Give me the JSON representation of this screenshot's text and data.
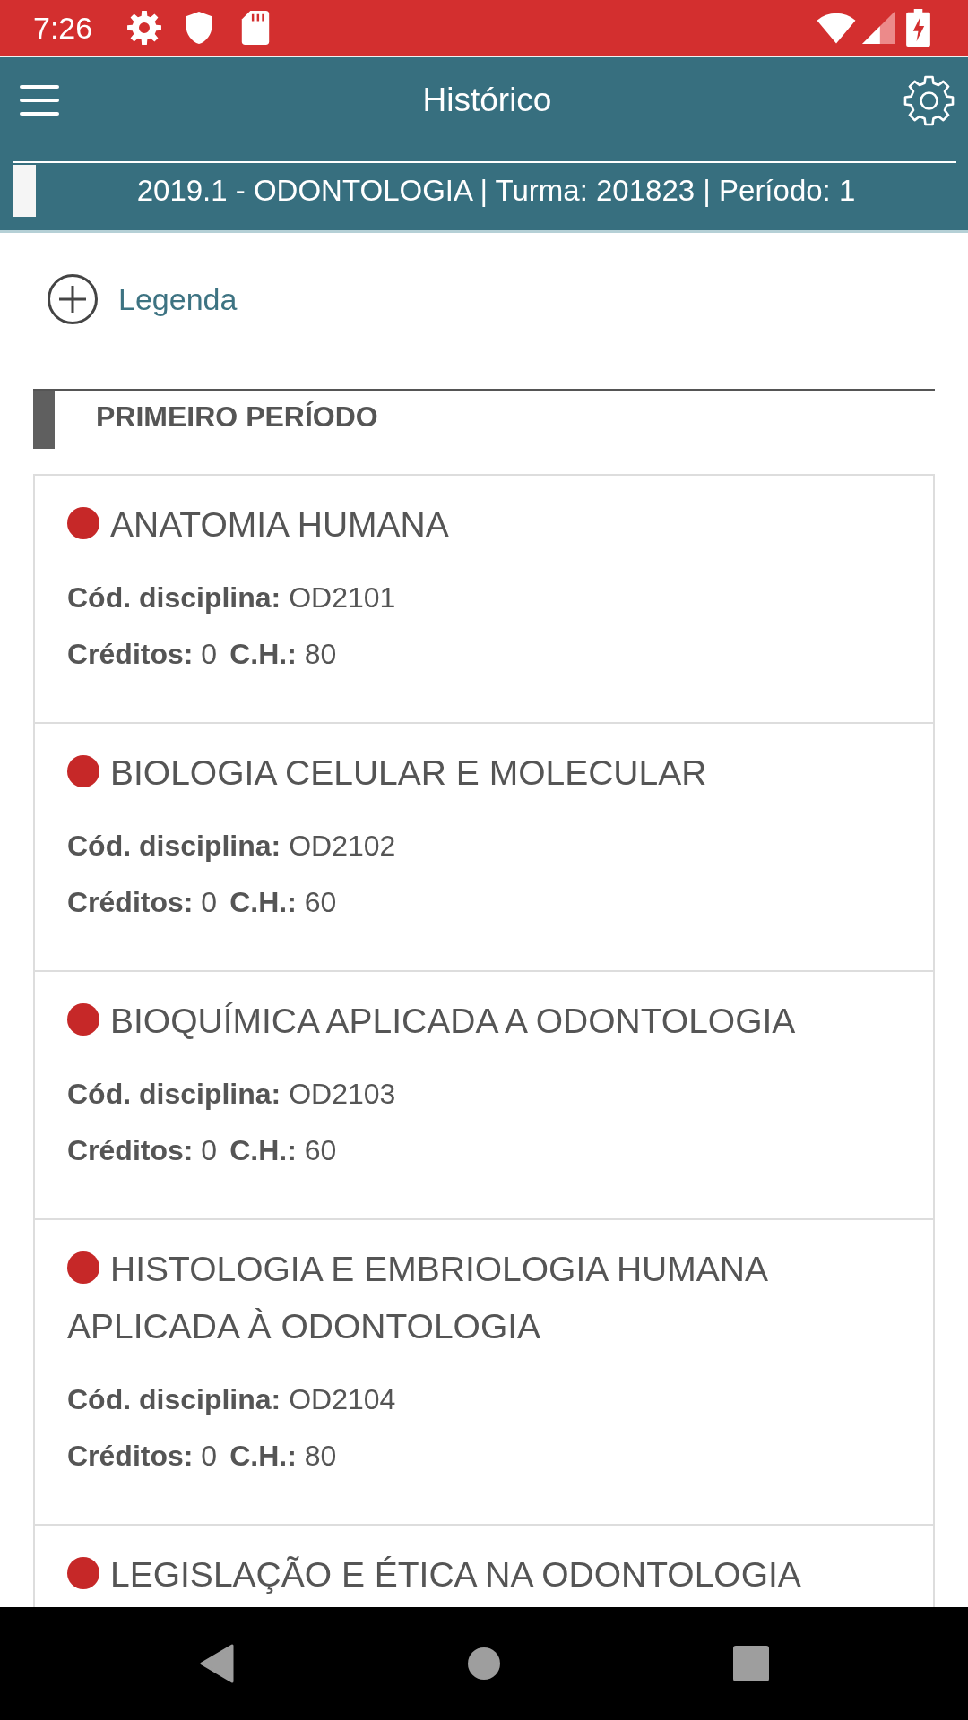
{
  "status_bar": {
    "time": "7:26"
  },
  "app_bar": {
    "title": "Histórico"
  },
  "course_banner": {
    "text": "2019.1 - ODONTOLOGIA | Turma: 201823 | Período: 1"
  },
  "legend": {
    "label": "Legenda"
  },
  "period": {
    "title": "PRIMEIRO PERÍODO",
    "subjects": [
      {
        "name": "ANATOMIA HUMANA",
        "color": "#c62828",
        "code": "**Cód. disciplina:** OD2101",
        "credits": "**Créditos:** 0",
        "hours": "**C.H.:** 80"
      },
      {
        "name": "BIOLOGIA CELULAR E MOLECULAR",
        "color": "#c62828",
        "code": "**Cód. disciplina:** OD2102",
        "credits": "**Créditos:** 0",
        "hours": "**C.H.:** 60"
      },
      {
        "name": "BIOQUÍMICA APLICADA A ODONTOLOGIA",
        "color": "#c62828",
        "code": "**Cód. disciplina:** OD2103",
        "credits": "**Créditos:** 0",
        "hours": "**C.H.:** 60"
      },
      {
        "name": "HISTOLOGIA E EMBRIOLOGIA HUMANA APLICADA À ODONTOLOGIA",
        "color": "#c62828",
        "code": "**Cód. disciplina:** OD2104",
        "credits": "**Créditos:** 0",
        "hours": "**C.H.:** 80"
      },
      {
        "name": "LEGISLAÇÃO E ÉTICA NA ODONTOLOGIA",
        "color": "#c62828"
      }
    ]
  }
}
